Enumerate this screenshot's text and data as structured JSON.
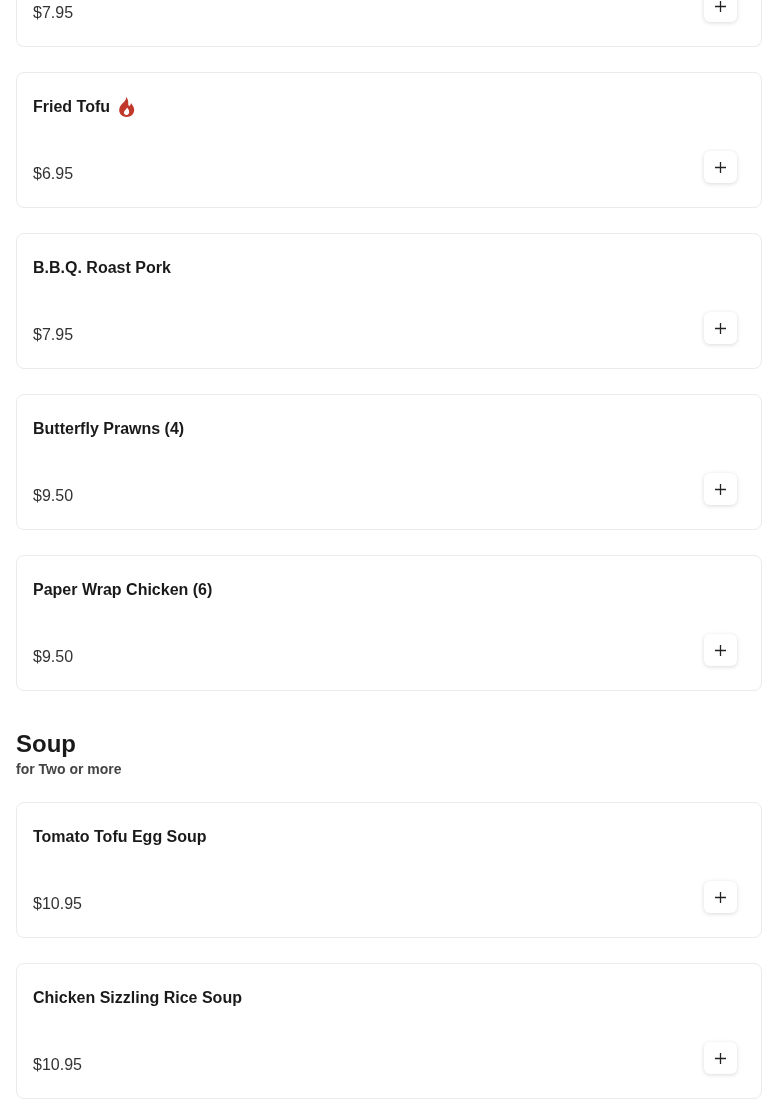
{
  "sections": [
    {
      "items": [
        {
          "kind": "partial",
          "price": "$7.95"
        },
        {
          "kind": "full",
          "name": "Fried Tofu",
          "spicy": true,
          "price": "$6.95"
        },
        {
          "kind": "full",
          "name": "B.B.Q. Roast Pork",
          "spicy": false,
          "price": "$7.95"
        },
        {
          "kind": "full",
          "name": "Butterfly Prawns (4)",
          "spicy": false,
          "price": "$9.50"
        },
        {
          "kind": "full",
          "name": "Paper Wrap Chicken (6)",
          "spicy": false,
          "price": "$9.50"
        }
      ]
    },
    {
      "title": "Soup",
      "subtitle": "for Two or more",
      "items": [
        {
          "kind": "full",
          "name": "Tomato Tofu Egg Soup",
          "spicy": false,
          "price": "$10.95"
        },
        {
          "kind": "full",
          "name": "Chicken Sizzling Rice Soup",
          "spicy": false,
          "price": "$10.95"
        }
      ]
    }
  ]
}
